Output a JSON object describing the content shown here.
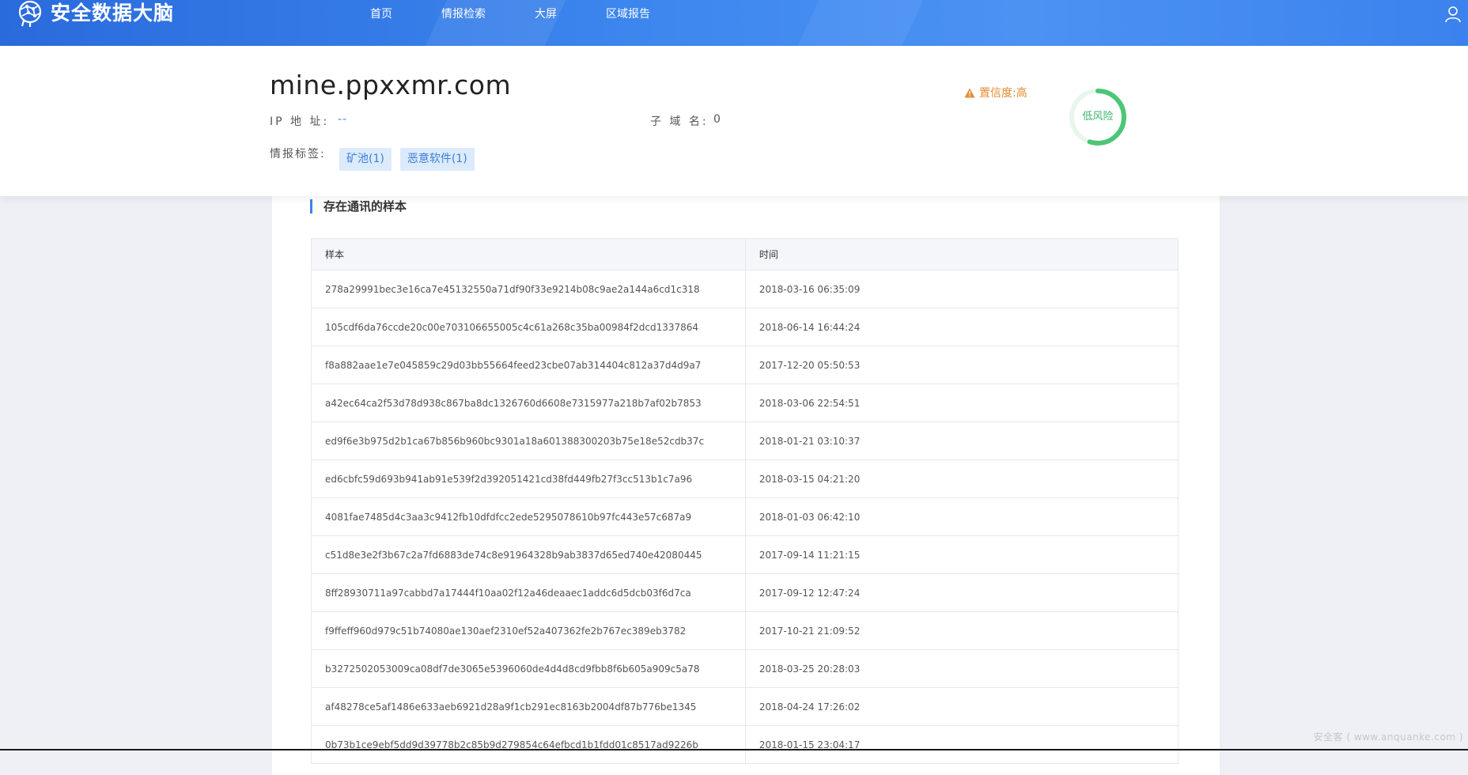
{
  "header": {
    "logo_text": "安全数据大脑",
    "nav": [
      {
        "label": "首页"
      },
      {
        "label": "情报检索"
      },
      {
        "label": "大屏"
      },
      {
        "label": "区域报告"
      }
    ]
  },
  "summary": {
    "domain": "mine.ppxxmr.com",
    "ip_label": "IP 地 址:",
    "ip_value": "--",
    "subdomain_label": "子 域 名:",
    "subdomain_value": "0",
    "tag_label": "情报标签:",
    "tags": [
      {
        "label": "矿池(1)"
      },
      {
        "label": "恶意软件(1)"
      }
    ],
    "confidence": "置信度:高",
    "risk_label": "低风险",
    "risk_level": 0.55,
    "colors": {
      "accent": "#3d85e6",
      "warning": "#e38b2f",
      "risk_ring": "#4cc676",
      "risk_track": "#e8f6ec"
    }
  },
  "samples": {
    "title": "存在通讯的样本",
    "columns": {
      "sample": "样本",
      "time": "时间"
    },
    "rows": [
      {
        "sample": "278a29991bec3e16ca7e45132550a71df90f33e9214b08c9ae2a144a6cd1c318",
        "time": "2018-03-16 06:35:09"
      },
      {
        "sample": "105cdf6da76ccde20c00e703106655005c4c61a268c35ba00984f2dcd1337864",
        "time": "2018-06-14 16:44:24"
      },
      {
        "sample": "f8a882aae1e7e045859c29d03bb55664feed23cbe07ab314404c812a37d4d9a7",
        "time": "2017-12-20 05:50:53"
      },
      {
        "sample": "a42ec64ca2f53d78d938c867ba8dc1326760d6608e7315977a218b7af02b7853",
        "time": "2018-03-06 22:54:51"
      },
      {
        "sample": "ed9f6e3b975d2b1ca67b856b960bc9301a18a601388300203b75e18e52cdb37c",
        "time": "2018-01-21 03:10:37"
      },
      {
        "sample": "ed6cbfc59d693b941ab91e539f2d392051421cd38fd449fb27f3cc513b1c7a96",
        "time": "2018-03-15 04:21:20"
      },
      {
        "sample": "4081fae7485d4c3aa3c9412fb10dfdfcc2ede5295078610b97fc443e57c687a9",
        "time": "2018-01-03 06:42:10"
      },
      {
        "sample": "c51d8e3e2f3b67c2a7fd6883de74c8e91964328b9ab3837d65ed740e42080445",
        "time": "2017-09-14 11:21:15"
      },
      {
        "sample": "8ff28930711a97cabbd7a17444f10aa02f12a46deaaec1addc6d5dcb03f6d7ca",
        "time": "2017-09-12 12:47:24"
      },
      {
        "sample": "f9ffeff960d979c51b74080ae130aef2310ef52a407362fe2b767ec389eb3782",
        "time": "2017-10-21 21:09:52"
      },
      {
        "sample": "b3272502053009ca08df7de3065e5396060de4d4d8cd9fbb8f6b605a909c5a78",
        "time": "2018-03-25 20:28:03"
      },
      {
        "sample": "af48278ce5af1486e633aeb6921d28a9f1cb291ec8163b2004df87b776be1345",
        "time": "2018-04-24 17:26:02"
      },
      {
        "sample": "0b73b1ce9ebf5dd9d39778b2c85b9d279854c64efbcd1b1fdd01c8517ad9226b",
        "time": "2018-01-15 23:04:17"
      }
    ]
  },
  "watermark": "安全客 ( www.anquanke.com )"
}
